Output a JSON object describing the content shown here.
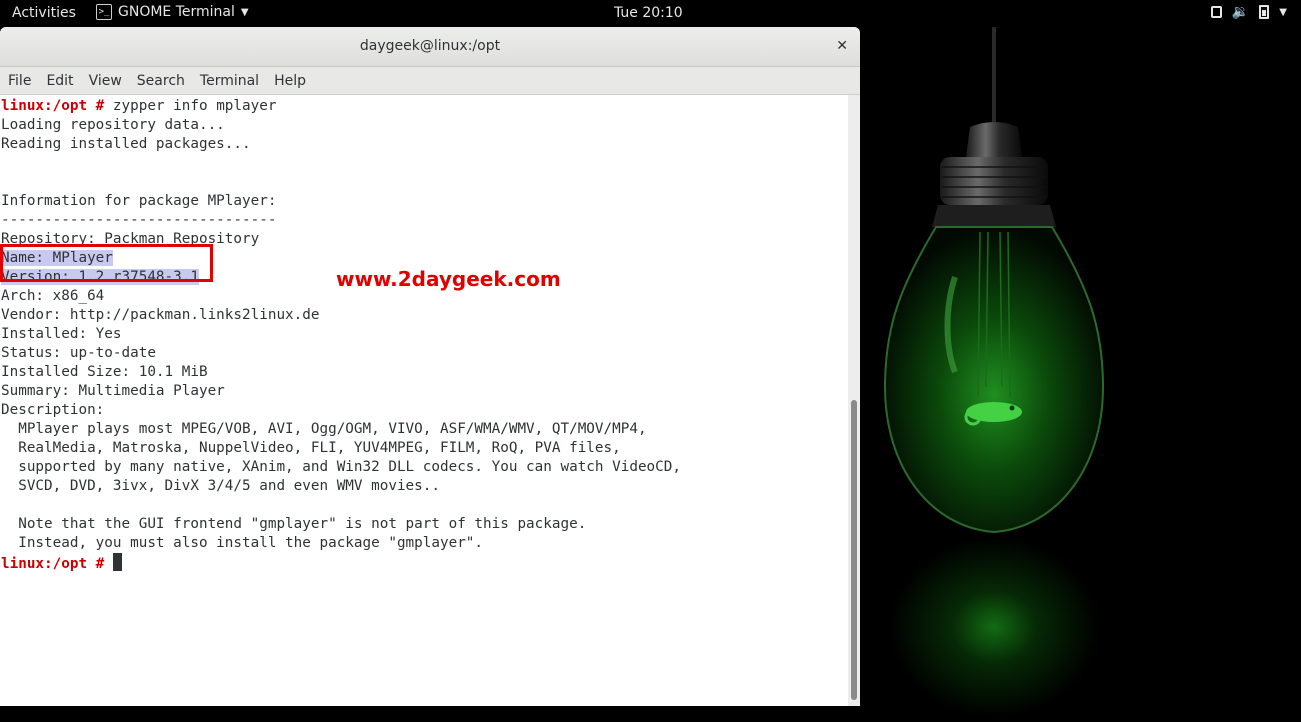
{
  "topbar": {
    "activities": "Activities",
    "app_name": "GNOME Terminal",
    "app_icon": "terminal-icon",
    "clock": "Tue 20:10",
    "tray_icons": [
      "window-icon",
      "volume-icon",
      "battery-icon",
      "chevron-down-icon"
    ]
  },
  "window": {
    "title": "daygeek@linux:/opt",
    "close_label": "✕",
    "menu": [
      "File",
      "Edit",
      "View",
      "Search",
      "Terminal",
      "Help"
    ]
  },
  "terminal": {
    "prompt": "linux:/opt # ",
    "lines": [
      {
        "prompt": "linux:/opt # ",
        "text": "zypper info mplayer"
      },
      {
        "text": "Loading repository data..."
      },
      {
        "text": "Reading installed packages..."
      },
      {
        "text": ""
      },
      {
        "text": ""
      },
      {
        "text": "Information for package MPlayer:"
      },
      {
        "text": "--------------------------------"
      },
      {
        "text": "Repository: Packman Repository"
      },
      {
        "text": "Name: MPlayer",
        "highlight": true
      },
      {
        "text": "Version: 1.2.r37548-3.1",
        "highlight": true
      },
      {
        "text": "Arch: x86_64"
      },
      {
        "text": "Vendor: http://packman.links2linux.de"
      },
      {
        "text": "Installed: Yes"
      },
      {
        "text": "Status: up-to-date"
      },
      {
        "text": "Installed Size: 10.1 MiB"
      },
      {
        "text": "Summary: Multimedia Player"
      },
      {
        "text": "Description:"
      },
      {
        "text": "  MPlayer plays most MPEG/VOB, AVI, Ogg/OGM, VIVO, ASF/WMA/WMV, QT/MOV/MP4,"
      },
      {
        "text": "  RealMedia, Matroska, NuppelVideo, FLI, YUV4MPEG, FILM, RoQ, PVA files,"
      },
      {
        "text": "  supported by many native, XAnim, and Win32 DLL codecs. You can watch VideoCD,"
      },
      {
        "text": "  SVCD, DVD, 3ivx, DivX 3/4/5 and even WMV movies.."
      },
      {
        "text": ""
      },
      {
        "text": "  Note that the GUI frontend \"gmplayer\" is not part of this package."
      },
      {
        "text": "  Instead, you must also install the package \"gmplayer\"."
      },
      {
        "prompt": "linux:/opt # ",
        "text": "",
        "cursor": true
      }
    ]
  },
  "watermark": "www.2daygeek.com",
  "colors": {
    "prompt": "#cc0000",
    "highlight": "#c8c8f0",
    "highlight_border": "#e00000",
    "watermark": "#e00000"
  },
  "wallpaper": {
    "icon": "lightbulb-icon",
    "logo": "chameleon-icon"
  }
}
